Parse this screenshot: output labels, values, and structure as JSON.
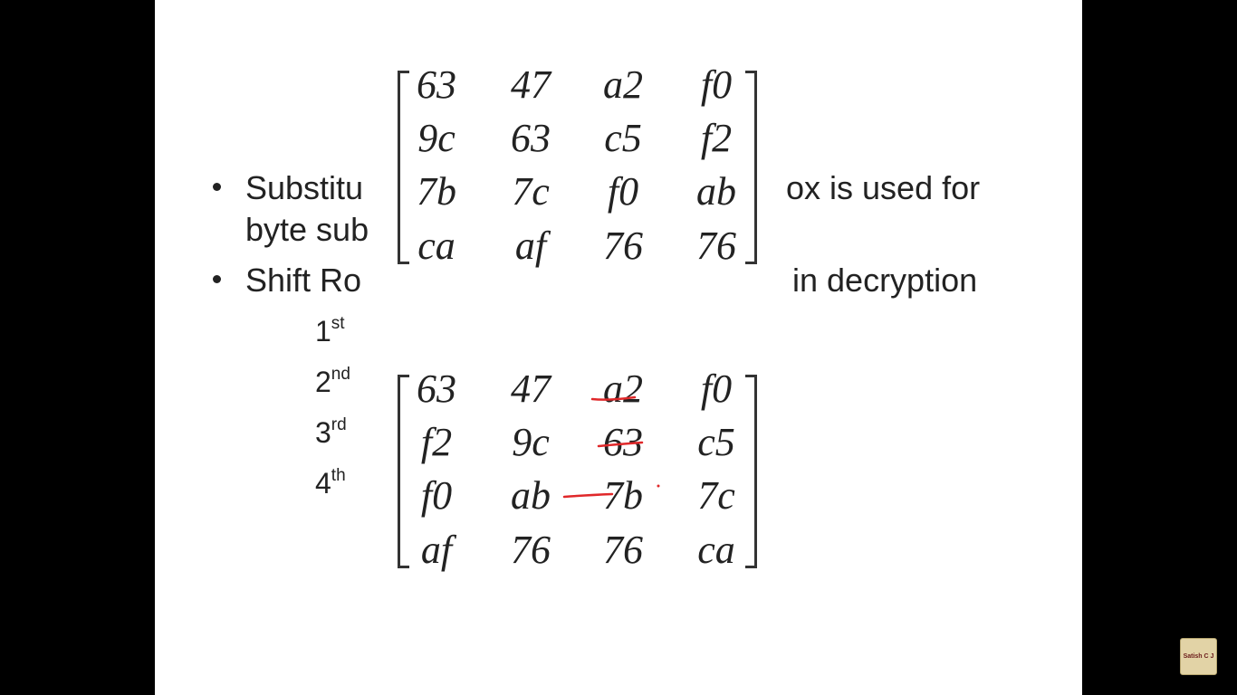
{
  "bullets": [
    {
      "line1_left": "Substitu",
      "line1_right": "ox is used for",
      "line2_left": "byte sub"
    },
    {
      "left": "Shift Ro",
      "right": "in decryption"
    }
  ],
  "ordinals": [
    {
      "num": "1",
      "sup": "st"
    },
    {
      "num": "2",
      "sup": "nd"
    },
    {
      "num": "3",
      "sup": "rd"
    },
    {
      "num": "4",
      "sup": "th"
    }
  ],
  "matrix_top": {
    "rows": [
      [
        "63",
        "47",
        "a2",
        "f0"
      ],
      [
        "9c",
        "63",
        "c5",
        "f2"
      ],
      [
        "7b",
        "7c",
        "f0",
        "ab"
      ],
      [
        "ca",
        "af",
        "76",
        "76"
      ]
    ]
  },
  "matrix_bottom": {
    "rows": [
      [
        "63",
        "47",
        "a2",
        "f0"
      ],
      [
        "f2",
        "9c",
        "63",
        "c5"
      ],
      [
        "f0",
        "ab",
        "7b",
        "7c"
      ],
      [
        "af",
        "76",
        "76",
        "ca"
      ]
    ]
  },
  "annotation_color": "#e0282a",
  "channel_badge": "Satish C J"
}
